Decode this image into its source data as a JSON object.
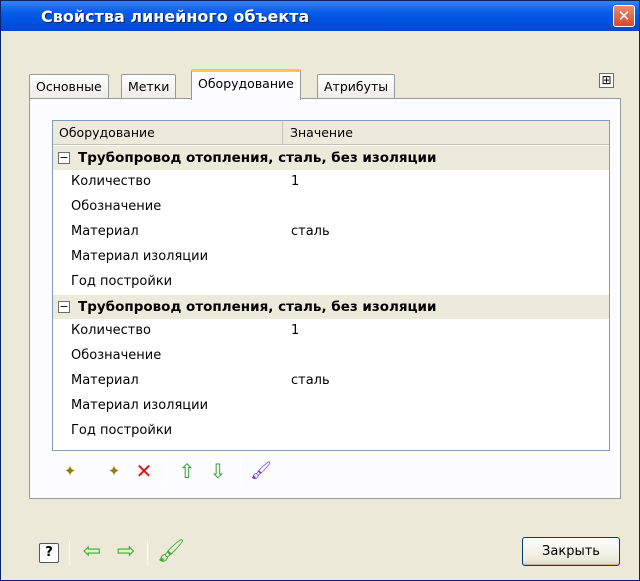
{
  "window": {
    "title": "Свойства линейного объекта",
    "close_glyph": "✕"
  },
  "tabs": [
    {
      "label": "Основные",
      "active": false
    },
    {
      "label": "Метки",
      "active": false
    },
    {
      "label": "Оборудование",
      "active": true
    },
    {
      "label": "Атрибуты",
      "active": false
    }
  ],
  "expand_glyph": "⊞",
  "grid": {
    "columns": [
      "Оборудование",
      "Значение"
    ],
    "groups": [
      {
        "toggle": "−",
        "title": "Трубопровод отопления, сталь, без изоляции",
        "properties": [
          {
            "name": "Количество",
            "value": "1"
          },
          {
            "name": "Обозначение",
            "value": ""
          },
          {
            "name": "Материал",
            "value": "сталь"
          },
          {
            "name": "Материал изоляции",
            "value": ""
          },
          {
            "name": "Год постройки",
            "value": ""
          }
        ]
      },
      {
        "toggle": "−",
        "title": "Трубопровод отопления, сталь, без изоляции",
        "properties": [
          {
            "name": "Количество",
            "value": "1"
          },
          {
            "name": "Обозначение",
            "value": ""
          },
          {
            "name": "Материал",
            "value": "сталь"
          },
          {
            "name": "Материал изоляции",
            "value": ""
          },
          {
            "name": "Год постройки",
            "value": ""
          }
        ]
      }
    ]
  },
  "toolbar": {
    "icons": [
      "new-item-icon",
      "new-subitem-icon",
      "delete-icon",
      "move-up-icon",
      "move-down-icon",
      "brush-icon"
    ],
    "glyphs": {
      "new": "✦",
      "del": "✕",
      "up": "⇧",
      "down": "⇩",
      "brush": "🖌"
    }
  },
  "bottom": {
    "help_glyph": "?",
    "back_glyph": "⇦",
    "forward_glyph": "⇨",
    "brush_glyph": "🖌",
    "close_label": "Закрыть"
  },
  "colors": {
    "titlebar": "#0054e3",
    "window_bg": "#ece9d8",
    "active_tab_accent": "#ffc83c",
    "delete_red": "#e21010",
    "arrow_green": "#2ea52e"
  }
}
